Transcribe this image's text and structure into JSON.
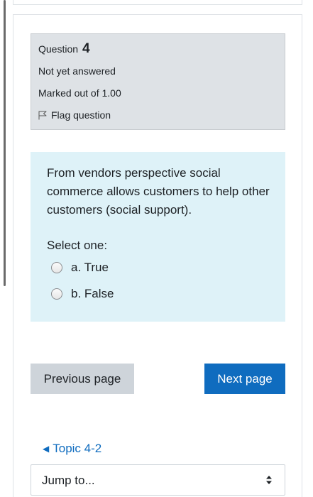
{
  "question": {
    "label": "Question",
    "number": "4",
    "state": "Not yet answered",
    "grade": "Marked out of 1.00",
    "flag_label": "Flag question",
    "text": "From vendors perspective social commerce allows customers to help other customers (social support).",
    "prompt": "Select one:",
    "options": [
      {
        "label": "a. True",
        "selected": false
      },
      {
        "label": "b. False",
        "selected": false
      }
    ]
  },
  "navigation": {
    "previous_label": "Previous page",
    "next_label": "Next page"
  },
  "activity_nav": {
    "prev_link": "Topic 4-2",
    "jump_placeholder": "Jump to..."
  },
  "colors": {
    "info_bg": "#dee2e6",
    "formulation_bg": "#def2f8",
    "primary": "#0f6cbf",
    "secondary_btn": "#ced4da"
  }
}
